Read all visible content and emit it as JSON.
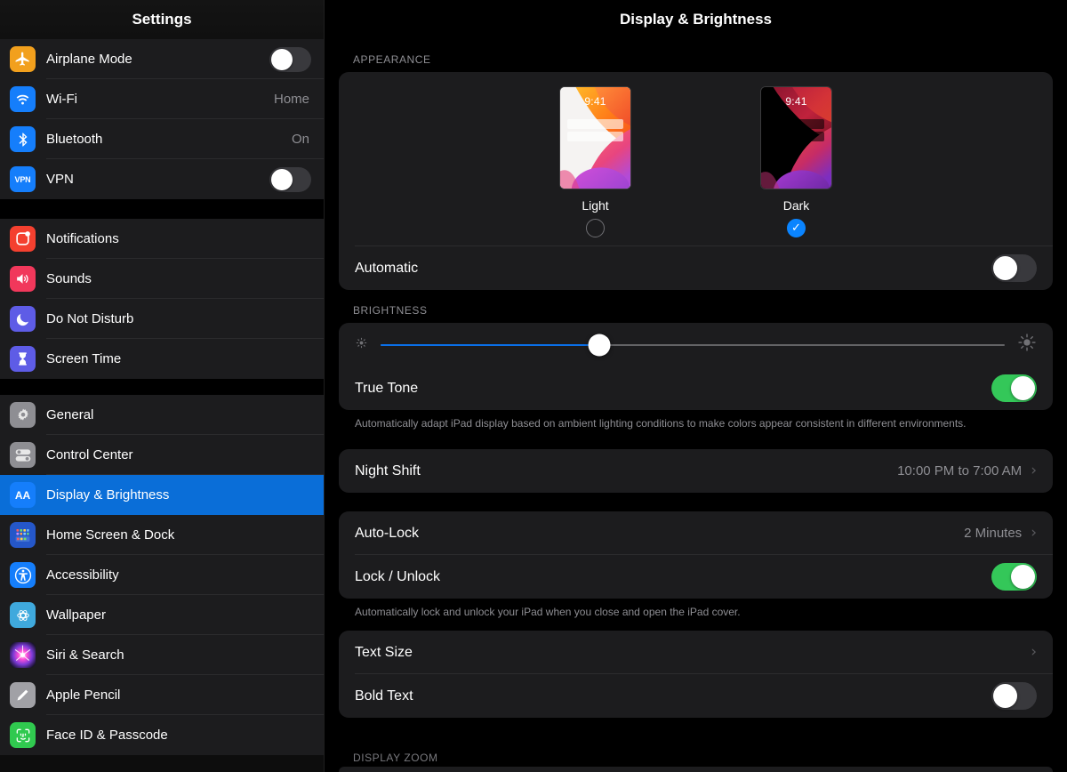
{
  "sidebar": {
    "title": "Settings",
    "groups": [
      {
        "items": [
          {
            "label": "Airplane Mode",
            "icon": "airplane-icon",
            "control": "toggle",
            "toggle_on": false
          },
          {
            "label": "Wi-Fi",
            "icon": "wifi-icon",
            "control": "value",
            "value": "Home"
          },
          {
            "label": "Bluetooth",
            "icon": "bluetooth-icon",
            "control": "value",
            "value": "On"
          },
          {
            "label": "VPN",
            "icon": "vpn-icon",
            "control": "toggle",
            "toggle_on": false
          }
        ]
      },
      {
        "items": [
          {
            "label": "Notifications",
            "icon": "notifications-icon",
            "control": "none"
          },
          {
            "label": "Sounds",
            "icon": "sounds-icon",
            "control": "none"
          },
          {
            "label": "Do Not Disturb",
            "icon": "moon-icon",
            "control": "none"
          },
          {
            "label": "Screen Time",
            "icon": "hourglass-icon",
            "control": "none"
          }
        ]
      },
      {
        "items": [
          {
            "label": "General",
            "icon": "gear-icon",
            "control": "none"
          },
          {
            "label": "Control Center",
            "icon": "control-center-icon",
            "control": "none"
          },
          {
            "label": "Display & Brightness",
            "icon": "aa-icon",
            "control": "none",
            "selected": true
          },
          {
            "label": "Home Screen & Dock",
            "icon": "home-screen-icon",
            "control": "none"
          },
          {
            "label": "Accessibility",
            "icon": "accessibility-icon",
            "control": "none"
          },
          {
            "label": "Wallpaper",
            "icon": "wallpaper-icon",
            "control": "none"
          },
          {
            "label": "Siri & Search",
            "icon": "siri-icon",
            "control": "none"
          },
          {
            "label": "Apple Pencil",
            "icon": "pencil-icon",
            "control": "none"
          },
          {
            "label": "Face ID & Passcode",
            "icon": "face-id-icon",
            "control": "none"
          }
        ]
      }
    ]
  },
  "main": {
    "title": "Display & Brightness",
    "appearance": {
      "header": "APPEARANCE",
      "themes": [
        {
          "name": "Light",
          "clock": "9:41",
          "selected": false
        },
        {
          "name": "Dark",
          "clock": "9:41",
          "selected": true
        }
      ],
      "automatic": {
        "label": "Automatic",
        "toggle_on": false
      }
    },
    "brightness": {
      "header": "BRIGHTNESS",
      "slider_value": 35,
      "low_icon": "brightness-low-icon",
      "high_icon": "brightness-high-icon",
      "true_tone": {
        "label": "True Tone",
        "toggle_on": true
      },
      "true_tone_footnote": "Automatically adapt iPad display based on ambient lighting conditions to make colors appear consistent in different environments."
    },
    "night_shift": {
      "label": "Night Shift",
      "value": "10:00 PM to 7:00 AM"
    },
    "auto_lock": {
      "label": "Auto-Lock",
      "value": "2 Minutes"
    },
    "lock_unlock": {
      "label": "Lock / Unlock",
      "toggle_on": true
    },
    "lock_unlock_footnote": "Automatically lock and unlock your iPad when you close and open the iPad cover.",
    "text_size": {
      "label": "Text Size"
    },
    "bold_text": {
      "label": "Bold Text",
      "toggle_on": false
    },
    "display_zoom": {
      "header": "DISPLAY ZOOM"
    }
  },
  "colors": {
    "accent_blue": "#0a84ff",
    "selected_row": "#0a6ed8",
    "toggle_green": "#34c759",
    "card_bg": "#1c1c1e",
    "secondary_text": "#8e8e93"
  }
}
